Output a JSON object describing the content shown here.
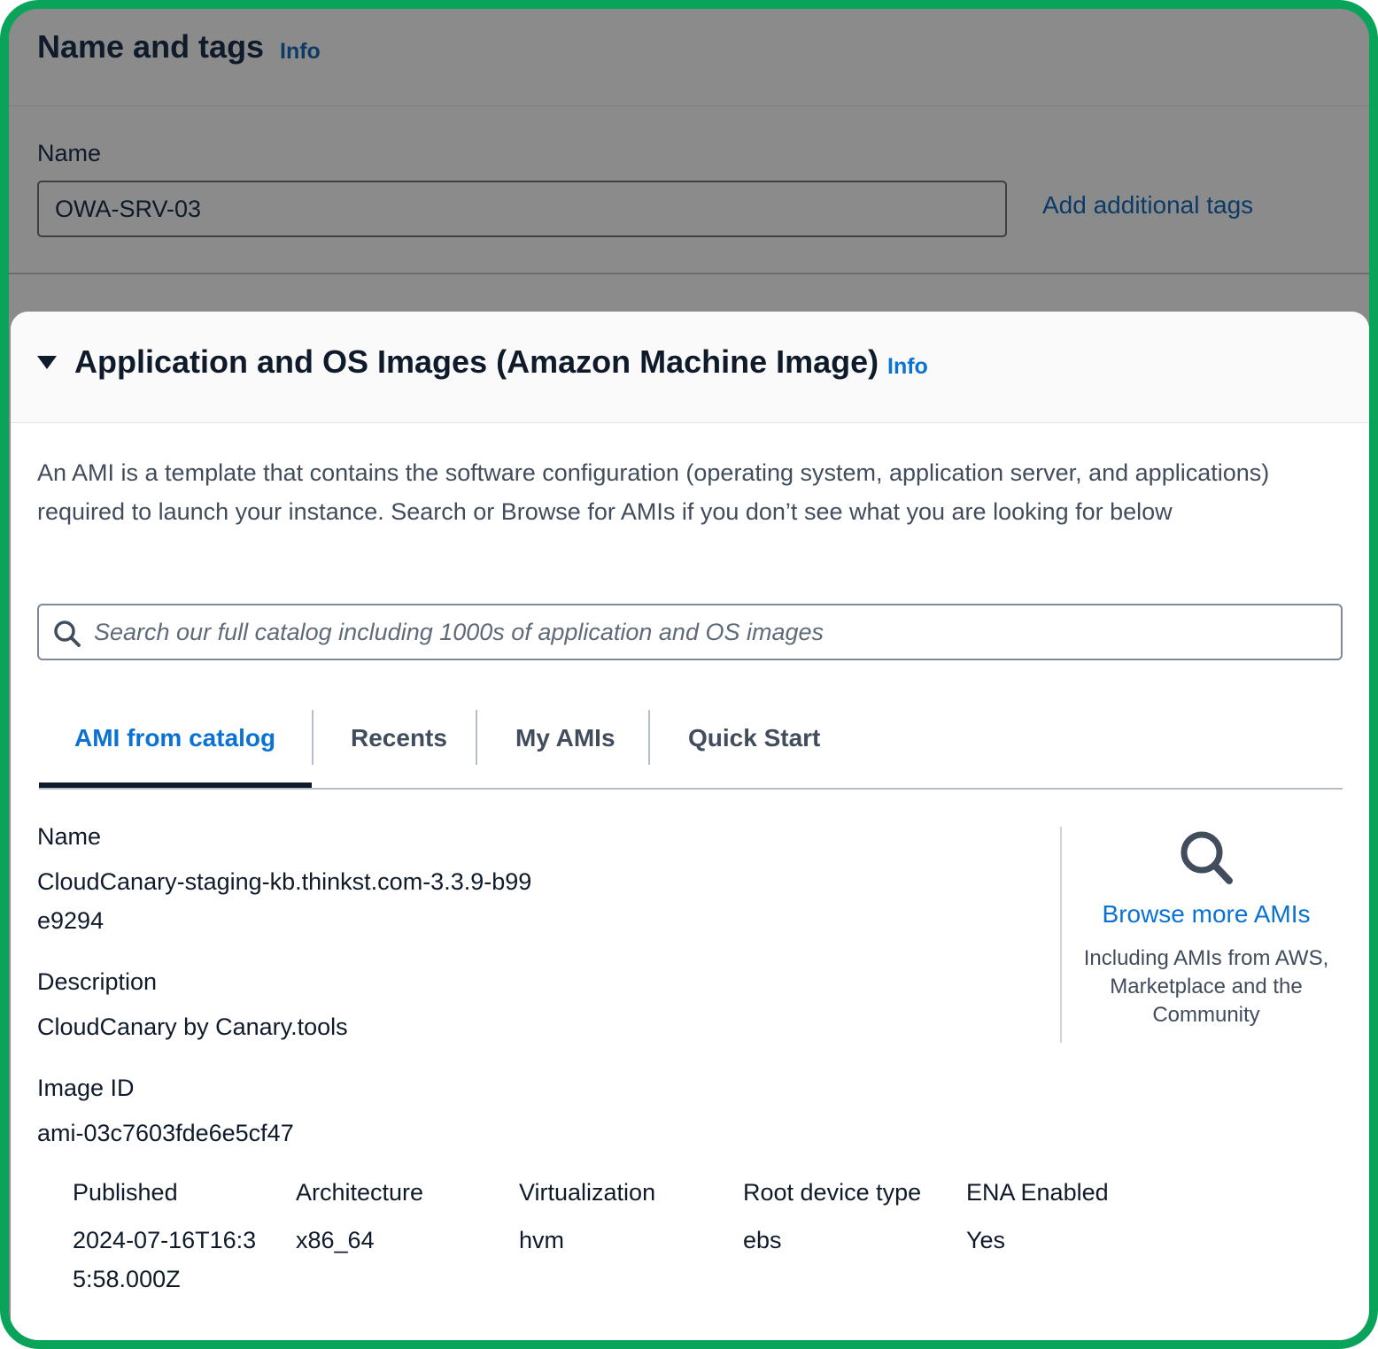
{
  "name_and_tags": {
    "title": "Name and tags",
    "info": "Info",
    "name_label": "Name",
    "name_value": "OWA-SRV-03",
    "add_tags": "Add additional tags"
  },
  "ami_section": {
    "title": "Application and OS Images (Amazon Machine Image)",
    "info": "Info",
    "description": "An AMI is a template that contains the software configuration (operating system, application server, and applications) required to launch your instance. Search or Browse for AMIs if you don’t see what you are looking for below",
    "search_placeholder": "Search our full catalog including 1000s of application and OS images",
    "tabs": [
      {
        "label": "AMI from catalog",
        "active": true
      },
      {
        "label": "Recents",
        "active": false
      },
      {
        "label": "My AMIs",
        "active": false
      },
      {
        "label": "Quick Start",
        "active": false
      }
    ],
    "selected_ami": {
      "name_label": "Name",
      "name_value": "CloudCanary-staging-kb.thinkst.com-3.3.9-b99e9294",
      "description_label": "Description",
      "description_value": "CloudCanary by Canary.tools",
      "image_id_label": "Image ID",
      "image_id_value": "ami-03c7603fde6e5cf47",
      "meta": [
        {
          "label": "Published",
          "value": "2024-07-16T16:35:58.000Z"
        },
        {
          "label": "Architecture",
          "value": "x86_64"
        },
        {
          "label": "Virtualization",
          "value": "hvm"
        },
        {
          "label": "Root device type",
          "value": "ebs"
        },
        {
          "label": "ENA Enabled",
          "value": "Yes"
        }
      ]
    },
    "browse": {
      "link": "Browse more AMIs",
      "subtext": "Including AMIs from AWS, Marketplace and the Community"
    }
  },
  "colors": {
    "frame_border": "#0aa35a",
    "link_blue": "#0972d3",
    "dim_overlay": "#8b8b8b"
  }
}
